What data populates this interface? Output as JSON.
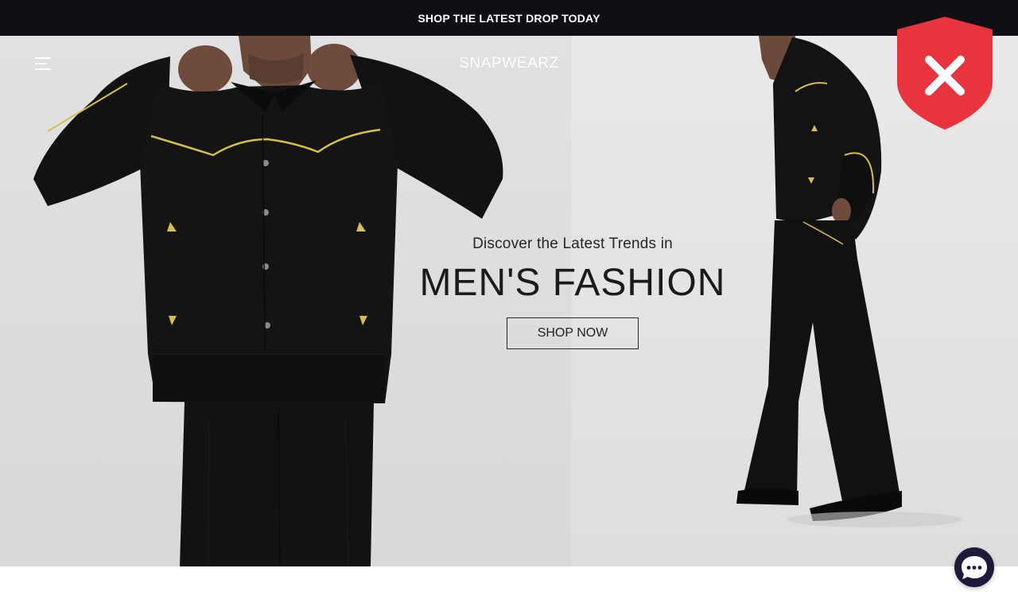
{
  "announcement": {
    "text": "SHOP THE LATEST DROP TODAY"
  },
  "header": {
    "brand": "SNAPWEARZ",
    "menu_icon": "hamburger-menu-icon"
  },
  "hero": {
    "subtitle": "Discover the Latest Trends in",
    "title": "MEN'S FASHION",
    "cta_label": "SHOP NOW"
  },
  "overlay": {
    "shield_icon": "shield-close-icon",
    "shield_color": "#e8343f"
  },
  "chat": {
    "icon": "chat-bubble-icon",
    "color": "#1e1b3a"
  },
  "colors": {
    "announcement_bg": "#110e14",
    "garment": "#111111",
    "trim": "#d4c04a"
  }
}
